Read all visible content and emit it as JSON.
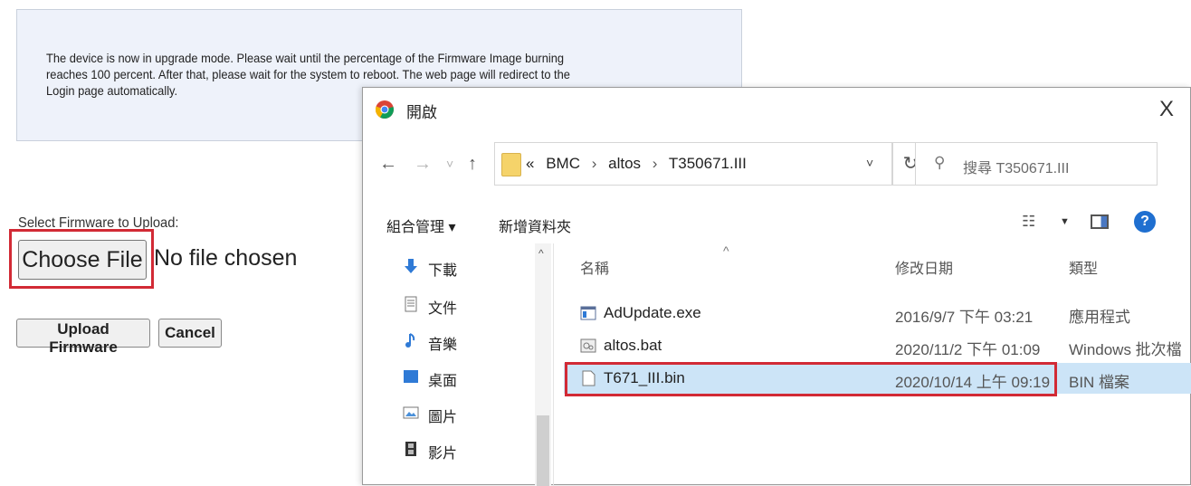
{
  "notice": {
    "text": "The device is now in upgrade mode. Please wait until the percentage of the Firmware Image burning reaches 100 percent. After that, please wait for the system to reboot. The web page will redirect to the Login page automatically."
  },
  "upload": {
    "label": "Select Firmware to Upload:",
    "choose_file": "Choose File",
    "no_file": "No file chosen",
    "upload_button": "Upload Firmware",
    "cancel_button": "Cancel"
  },
  "dialog": {
    "title": "開啟",
    "close": "X",
    "nav_back": "←",
    "nav_forward": "→",
    "nav_recent": "˅",
    "nav_up": "↑",
    "breadcrumb": [
      "«",
      "BMC",
      "altos",
      "T350671.III"
    ],
    "search_placeholder": "搜尋 T350671.III",
    "toolbar": {
      "organize": "組合管理 ▾",
      "new_folder": "新增資料夾"
    },
    "help": "?",
    "sidebar": [
      {
        "label": "下載",
        "icon": "download-icon"
      },
      {
        "label": "文件",
        "icon": "document-icon"
      },
      {
        "label": "音樂",
        "icon": "music-icon"
      },
      {
        "label": "桌面",
        "icon": "desktop-icon"
      },
      {
        "label": "圖片",
        "icon": "pictures-icon"
      },
      {
        "label": "影片",
        "icon": "videos-icon"
      }
    ],
    "columns": {
      "name": "名稱",
      "modified": "修改日期",
      "type": "類型"
    },
    "files": [
      {
        "name": "AdUpdate.exe",
        "modified": "2016/9/7 下午 03:21",
        "type": "應用程式",
        "icon": "exe-icon",
        "selected": false
      },
      {
        "name": "altos.bat",
        "modified": "2020/11/2 下午 01:09",
        "type": "Windows 批次檔",
        "icon": "bat-icon",
        "selected": false
      },
      {
        "name": "T671_III.bin",
        "modified": "2020/10/14 上午 09:19",
        "type": "BIN 檔案",
        "icon": "file-icon",
        "selected": true
      }
    ]
  },
  "colors": {
    "highlight_red": "#d22a35",
    "selection_blue": "#cce4f7",
    "notice_bg": "#eef2fa"
  }
}
